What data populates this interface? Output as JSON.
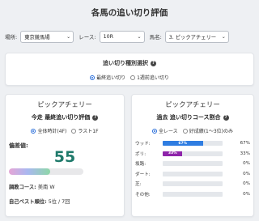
{
  "page": {
    "title": "各馬の追い切り評価"
  },
  "filters": {
    "venue": {
      "label": "場所:",
      "value": "東京競馬場"
    },
    "race": {
      "label": "レース:",
      "value": "10R"
    },
    "horse": {
      "label": "馬名:",
      "value": "3. ピックアチェリー"
    }
  },
  "type_select": {
    "title": "追い切り種別選択",
    "options": [
      {
        "label": "最終追い切り",
        "selected": true
      },
      {
        "label": "1週前追い切り",
        "selected": false
      }
    ]
  },
  "eval_card": {
    "horse_name": "ピックアチェリー",
    "subtitle": "今走 最終追い切り評価",
    "options": [
      {
        "label": "全体時計(4F)",
        "selected": true
      },
      {
        "label": "ラスト1F",
        "selected": false
      }
    ],
    "score_label": "偏差値:",
    "score": "55",
    "score_fraction": 0.55,
    "course_label": "調教コース:",
    "course_value": "美南 W",
    "best_label": "自己ベスト順位:",
    "best_value": "5位 / 7回"
  },
  "course_card": {
    "horse_name": "ピックアチェリー",
    "subtitle": "過去 追い切りコース割合",
    "options": [
      {
        "label": "全レース",
        "selected": true
      },
      {
        "label": "好成績(1〜3位)のみ",
        "selected": false
      }
    ],
    "rows": [
      {
        "label": "ウッド:",
        "bar_text": "67%",
        "value": 67,
        "pct": "67%",
        "color": "#2f7de1"
      },
      {
        "label": "ポリ:",
        "bar_text": "33%",
        "value": 33,
        "pct": "33%",
        "color": "#8e24aa"
      },
      {
        "label": "坂路:",
        "bar_text": "",
        "value": 0,
        "pct": "0%",
        "color": "#2f7de1"
      },
      {
        "label": "ダート:",
        "bar_text": "",
        "value": 0,
        "pct": "0%",
        "color": "#2f7de1"
      },
      {
        "label": "芝:",
        "bar_text": "",
        "value": 0,
        "pct": "0%",
        "color": "#2f7de1"
      },
      {
        "label": "その他:",
        "bar_text": "",
        "value": 0,
        "pct": "0%",
        "color": "#2f7de1"
      }
    ]
  },
  "icons": {
    "help": "question-circle-icon",
    "dropdown": "chevron-down-icon"
  },
  "colors": {
    "score": "#1f7a6b",
    "accent": "#2a6fdb"
  }
}
